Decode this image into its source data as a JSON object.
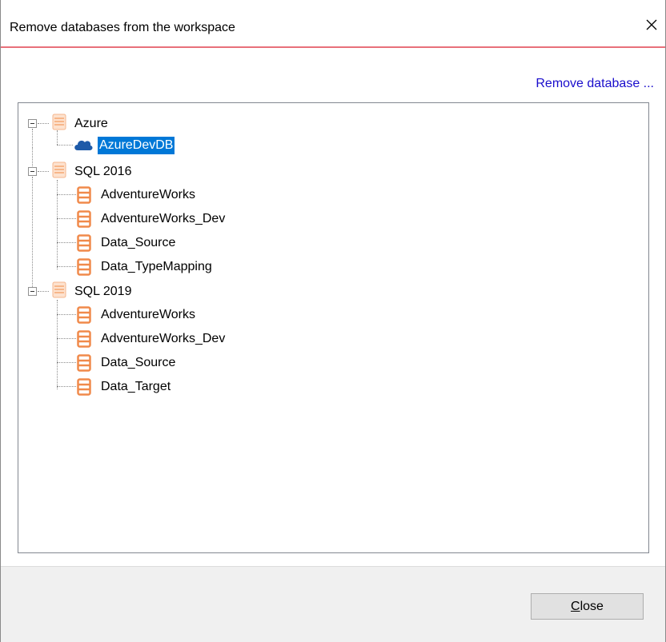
{
  "dialog": {
    "title": "Remove databases from the workspace",
    "close_glyph": "✕",
    "remove_link": "Remove database ...",
    "close_button": {
      "mnemonic": "C",
      "rest": "lose"
    }
  },
  "tree": {
    "groups": [
      {
        "label": "Azure",
        "items": [
          "AzureDevDB"
        ]
      },
      {
        "label": "SQL 2016",
        "items": [
          "AdventureWorks",
          "AdventureWorks_Dev",
          "Data_Source",
          "Data_TypeMapping"
        ]
      },
      {
        "label": "SQL 2019",
        "items": [
          "AdventureWorks",
          "AdventureWorks_Dev",
          "Data_Source",
          "Data_Target"
        ]
      }
    ],
    "selected_item": "AzureDevDB"
  },
  "colors": {
    "accent_line": "#e8707a",
    "selection": "#0078d7",
    "link": "#1a0dcc",
    "db_icon": "#f08a4b",
    "cloud_icon": "#1e5aa8"
  }
}
